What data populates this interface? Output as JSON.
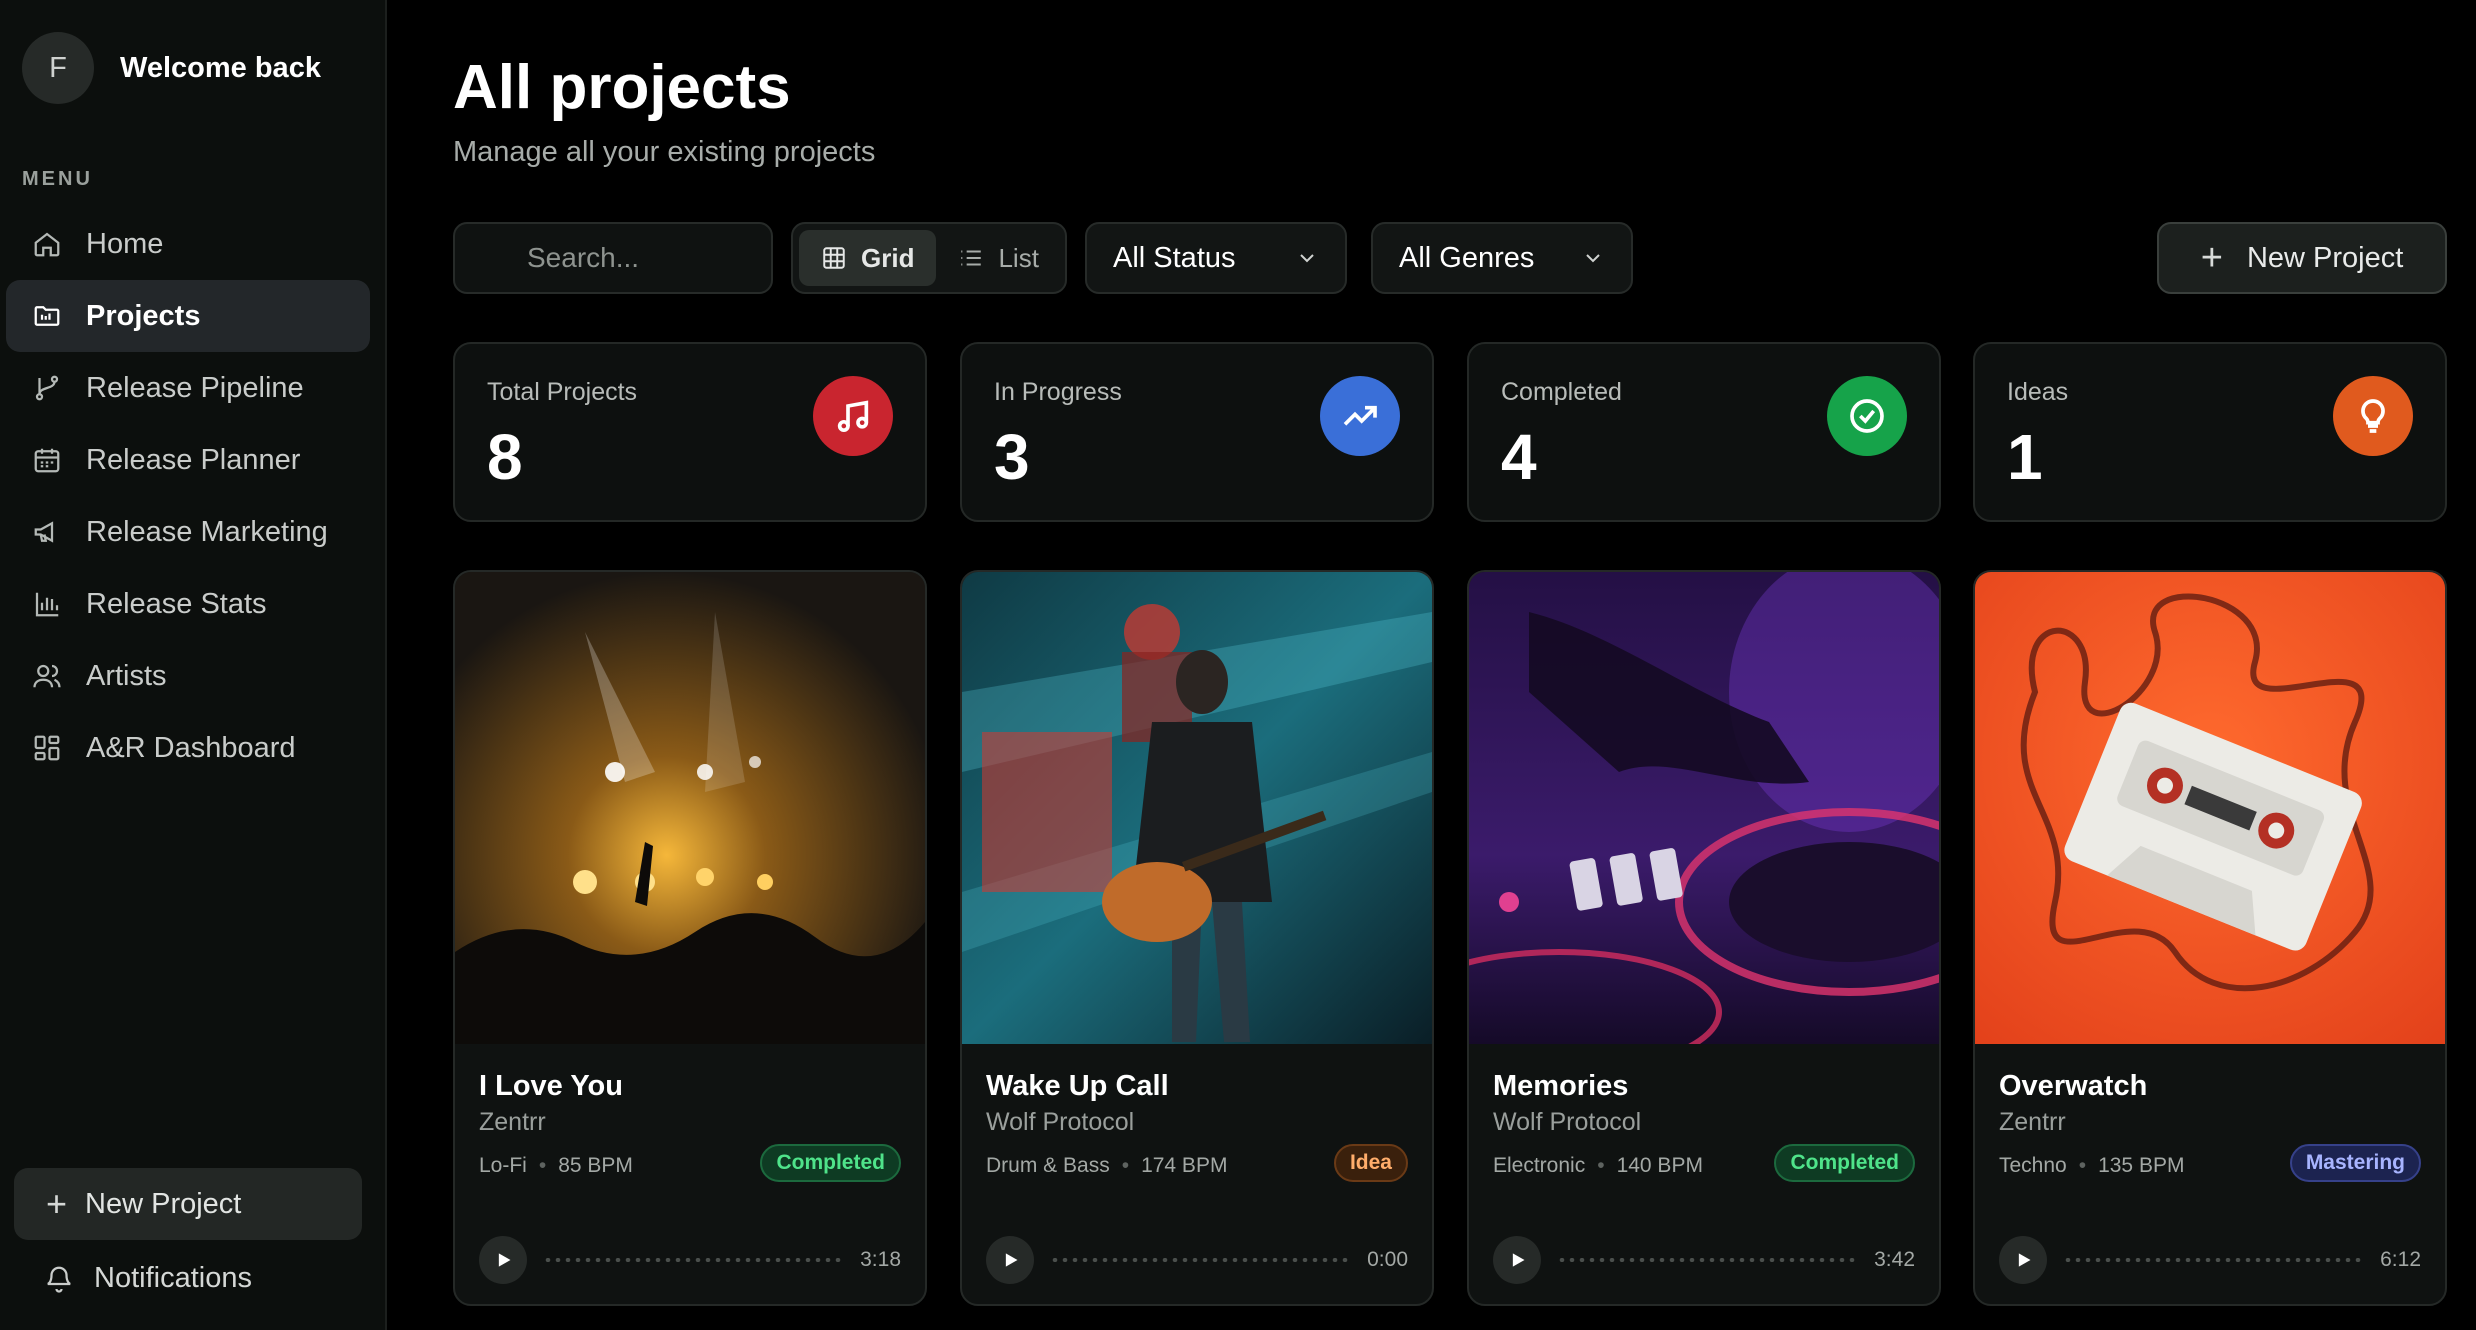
{
  "user": {
    "initial": "F",
    "greeting": "Welcome back"
  },
  "sidebar": {
    "menu_label": "MENU",
    "items": [
      {
        "label": "Home",
        "icon": "home-icon"
      },
      {
        "label": "Projects",
        "icon": "folder-icon",
        "active": true
      },
      {
        "label": "Release Pipeline",
        "icon": "git-branch-icon"
      },
      {
        "label": "Release Planner",
        "icon": "calendar-icon"
      },
      {
        "label": "Release Marketing",
        "icon": "megaphone-icon"
      },
      {
        "label": "Release Stats",
        "icon": "bar-chart-icon"
      },
      {
        "label": "Artists",
        "icon": "users-icon"
      },
      {
        "label": "A&R Dashboard",
        "icon": "dashboard-icon"
      }
    ],
    "new_project": "New Project",
    "notifications": "Notifications"
  },
  "header": {
    "title": "All projects",
    "subtitle": "Manage all your existing projects"
  },
  "toolbar": {
    "search_placeholder": "Search...",
    "view_grid": "Grid",
    "view_list": "List",
    "status_filter": "All Status",
    "genre_filter": "All Genres",
    "new_project": "New Project"
  },
  "stats": [
    {
      "label": "Total Projects",
      "value": "8",
      "icon": "music-note-icon",
      "color": "#c9252f"
    },
    {
      "label": "In Progress",
      "value": "3",
      "icon": "trending-up-icon",
      "color": "#3a6fd8"
    },
    {
      "label": "Completed",
      "value": "4",
      "icon": "check-circle-icon",
      "color": "#16a34a"
    },
    {
      "label": "Ideas",
      "value": "1",
      "icon": "lightbulb-icon",
      "color": "#e05a1e"
    }
  ],
  "projects": [
    {
      "title": "I Love You",
      "artist": "Zentrr",
      "genre": "Lo-Fi",
      "bpm": "85 BPM",
      "status": "Completed",
      "duration": "3:18"
    },
    {
      "title": "Wake Up Call",
      "artist": "Wolf Protocol",
      "genre": "Drum & Bass",
      "bpm": "174 BPM",
      "status": "Idea",
      "duration": "0:00"
    },
    {
      "title": "Memories",
      "artist": "Wolf Protocol",
      "genre": "Electronic",
      "bpm": "140 BPM",
      "status": "Completed",
      "duration": "3:42"
    },
    {
      "title": "Overwatch",
      "artist": "Zentrr",
      "genre": "Techno",
      "bpm": "135 BPM",
      "status": "Mastering",
      "duration": "6:12"
    }
  ]
}
